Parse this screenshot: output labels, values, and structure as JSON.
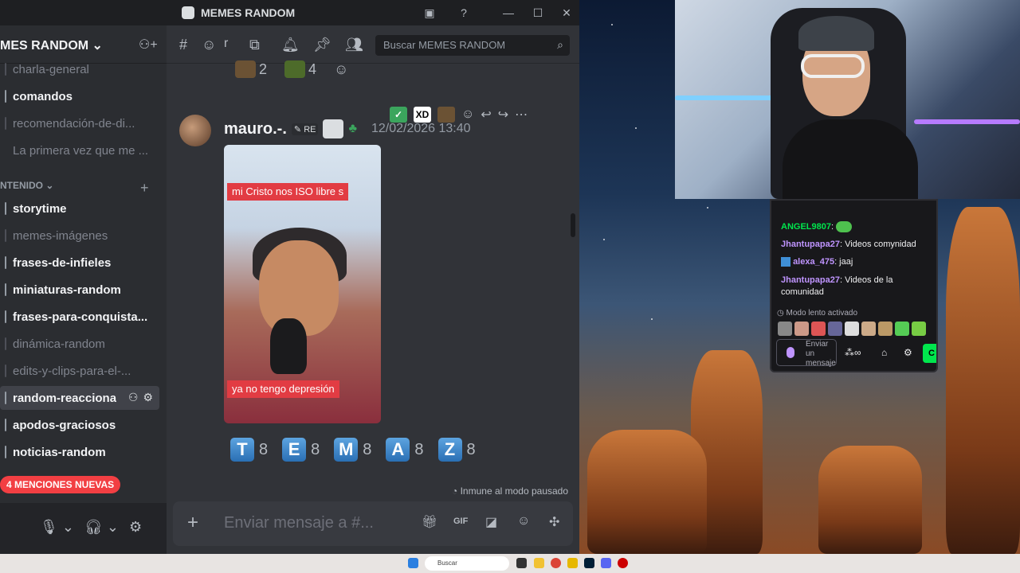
{
  "window": {
    "title": "MEMES RANDOM"
  },
  "server": {
    "name": "MES RANDOM",
    "category_label": "NTENIDO"
  },
  "channels_top": [
    {
      "label": "charla-general",
      "state": "read"
    },
    {
      "label": "comandos",
      "state": "unread"
    },
    {
      "label": "recomendación-de-di...",
      "state": "read"
    },
    {
      "label": "La primera vez que me ...",
      "state": "read"
    }
  ],
  "channels": [
    {
      "label": "storytime",
      "state": "unread"
    },
    {
      "label": "memes-imágenes",
      "state": "read"
    },
    {
      "label": "frases-de-infieles",
      "state": "unread"
    },
    {
      "label": "miniaturas-random",
      "state": "unread"
    },
    {
      "label": "frases-para-conquista...",
      "state": "unread"
    },
    {
      "label": "dinámica-random",
      "state": "read"
    },
    {
      "label": "edits-y-clips-para-el-...",
      "state": "read"
    },
    {
      "label": "random-reacciona",
      "state": "active"
    },
    {
      "label": "apodos-graciosos",
      "state": "unread"
    },
    {
      "label": "noticias-random",
      "state": "unread"
    }
  ],
  "mentions_pill": "4 MENCIONES NUEVAS",
  "header": {
    "channel_prefix": "#",
    "channel_short": "r",
    "search_placeholder": "Buscar MEMES RANDOM"
  },
  "top_reactions": [
    {
      "count": "2"
    },
    {
      "count": "4"
    }
  ],
  "message": {
    "author": "mauro.-.",
    "badge": "RE",
    "timestamp": "12/02/2026 13:40",
    "caption_top": "mi Cristo nos ISO libre s",
    "caption_bottom": "ya no tengo depresión"
  },
  "toolbar": {
    "xd_label": "XD"
  },
  "vote_reactions": [
    {
      "letter": "T",
      "count": "8"
    },
    {
      "letter": "E",
      "count": "8"
    },
    {
      "letter": "M",
      "count": "8"
    },
    {
      "letter": "A",
      "count": "8"
    },
    {
      "letter": "Z",
      "count": "8"
    }
  ],
  "slowmode_notice": "Inmune al modo pausado",
  "composer": {
    "placeholder": "Enviar mensaje a #..."
  },
  "twitch_chat": {
    "messages": [
      {
        "user": "ANGEL9807",
        "color": "#00e64d",
        "text": ""
      },
      {
        "user": "Jhantupapa27",
        "color": "#bf94ff",
        "text": " Videos comynidad"
      },
      {
        "user": "alexa_475",
        "color": "#bf94ff",
        "text": " jaaj"
      },
      {
        "user": "Jhantupapa27",
        "color": "#bf94ff",
        "text": " Videos de la comunidad"
      }
    ],
    "slow_mode": "Modo lento activado",
    "input_placeholder": "Enviar un mensaje",
    "chat_button": "C"
  },
  "taskbar": {
    "search_label": "Buscar"
  }
}
